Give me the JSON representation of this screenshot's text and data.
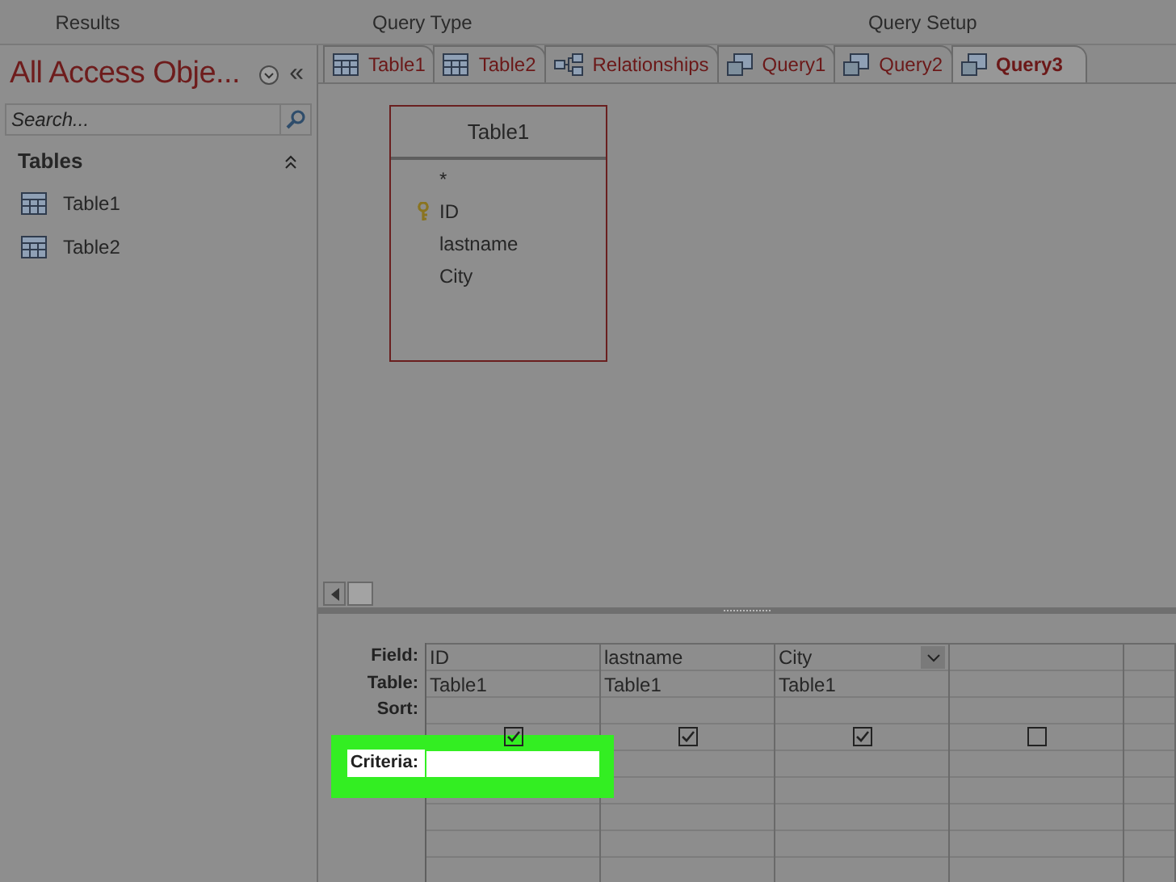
{
  "ribbon_groups": [
    {
      "label": "Results"
    },
    {
      "label": "Query Type"
    },
    {
      "label": "Query Setup"
    }
  ],
  "nav_pane": {
    "title": "All Access Obje...",
    "collapse": "«",
    "search": {
      "placeholder": "Search..."
    },
    "groups": [
      {
        "label": "Tables",
        "expanded": true,
        "items": [
          {
            "label": "Table1"
          },
          {
            "label": "Table2"
          }
        ]
      }
    ]
  },
  "tabs": [
    {
      "label": "Table1",
      "kind": "table",
      "selected": false
    },
    {
      "label": "Table2",
      "kind": "table",
      "selected": false
    },
    {
      "label": "Relationships",
      "kind": "relationships",
      "selected": false
    },
    {
      "label": "Query1",
      "kind": "query",
      "selected": false
    },
    {
      "label": "Query2",
      "kind": "query",
      "selected": false
    },
    {
      "label": "Query3",
      "kind": "query",
      "selected": true
    }
  ],
  "table_box": {
    "title": "Table1",
    "fields": [
      {
        "label": "*",
        "primary_key": false
      },
      {
        "label": "ID",
        "primary_key": true
      },
      {
        "label": "lastname",
        "primary_key": false
      },
      {
        "label": "City",
        "primary_key": false
      }
    ]
  },
  "grid": {
    "rows": [
      {
        "kind": "field",
        "label": "Field:",
        "highlighted": false
      },
      {
        "kind": "table",
        "label": "Table:",
        "highlighted": false
      },
      {
        "kind": "sort",
        "label": "Sort:",
        "highlighted": false
      },
      {
        "kind": "show",
        "highlighted": false
      },
      {
        "kind": "criteria",
        "label": "Criteria:",
        "highlighted": true
      }
    ],
    "columns": [
      {
        "field": "ID",
        "table": "Table1",
        "show": true,
        "dropdown": false
      },
      {
        "field": "lastname",
        "table": "Table1",
        "show": true,
        "dropdown": false
      },
      {
        "field": "City",
        "table": "Table1",
        "show": true,
        "dropdown": true
      },
      {
        "show": false,
        "dropdown": false
      }
    ]
  }
}
